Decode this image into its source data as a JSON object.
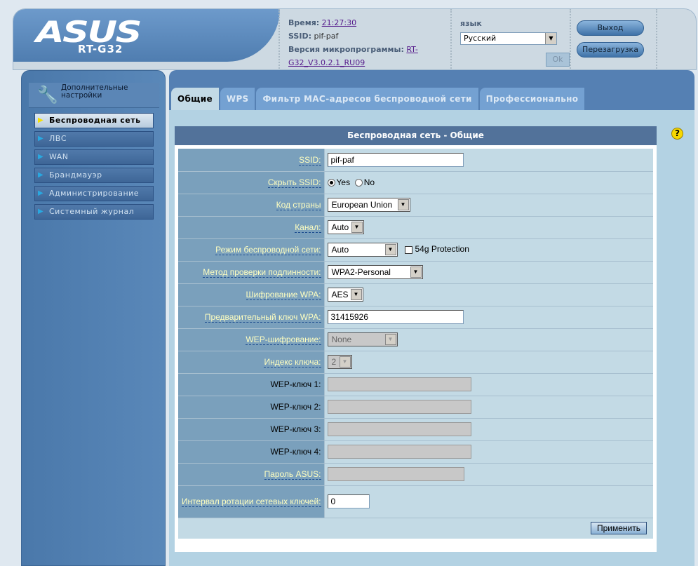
{
  "header": {
    "brand": "ASUS",
    "model": "RT-G32",
    "time_label": "Время:",
    "time": "21:27:30",
    "ssid_label": "SSID:",
    "ssid": "pif-paf",
    "fw_label": "Версия микропрограммы:",
    "fw": "RT-G32_V3.0.2.1_RU09",
    "lang_label": "язык",
    "lang_value": "Русский",
    "ok": "Ok",
    "logout": "Выход",
    "reboot": "Перезагрузка"
  },
  "sidebar": {
    "title": "Дополнительные настройки",
    "items": [
      {
        "label": "Беспроводная сеть",
        "active": true
      },
      {
        "label": "ЛВС"
      },
      {
        "label": "WAN"
      },
      {
        "label": "Брандмауэр"
      },
      {
        "label": "Администрирование"
      },
      {
        "label": "Системный журнал"
      }
    ]
  },
  "tabs": [
    "Общие",
    "WPS",
    "Фильтр MAC-адресов беспроводной сети",
    "Профессионально"
  ],
  "title": "Беспроводная сеть - Общие",
  "form": {
    "ssid": {
      "label": "SSID:",
      "value": "pif-paf"
    },
    "hide": {
      "label": "Скрыть SSID:",
      "yes": "Yes",
      "no": "No",
      "selected": "Yes"
    },
    "country": {
      "label": "Код страны",
      "value": "European Union"
    },
    "channel": {
      "label": "Канал:",
      "value": "Auto"
    },
    "mode": {
      "label": "Режим беспроводной сети:",
      "value": "Auto",
      "protection": "54g Protection"
    },
    "auth": {
      "label": "Метод проверки подлинности:",
      "value": "WPA2-Personal"
    },
    "wpaenc": {
      "label": "Шифрование WPA:",
      "value": "AES"
    },
    "psk": {
      "label": "Предварительный ключ WPA:",
      "value": "31415926"
    },
    "wepenc": {
      "label": "WEP-шифрование:",
      "value": "None"
    },
    "keyidx": {
      "label": "Индекс ключа:",
      "value": "2"
    },
    "wep1": {
      "label": "WEP-ключ 1:",
      "value": ""
    },
    "wep2": {
      "label": "WEP-ключ 2:",
      "value": ""
    },
    "wep3": {
      "label": "WEP-ключ 3:",
      "value": ""
    },
    "wep4": {
      "label": "WEP-ключ 4:",
      "value": ""
    },
    "asuspw": {
      "label": "Пароль ASUS:",
      "value": ""
    },
    "interval": {
      "label": "Интервал ротации сетевых ключей:",
      "value": "0"
    },
    "apply": "Применить"
  }
}
